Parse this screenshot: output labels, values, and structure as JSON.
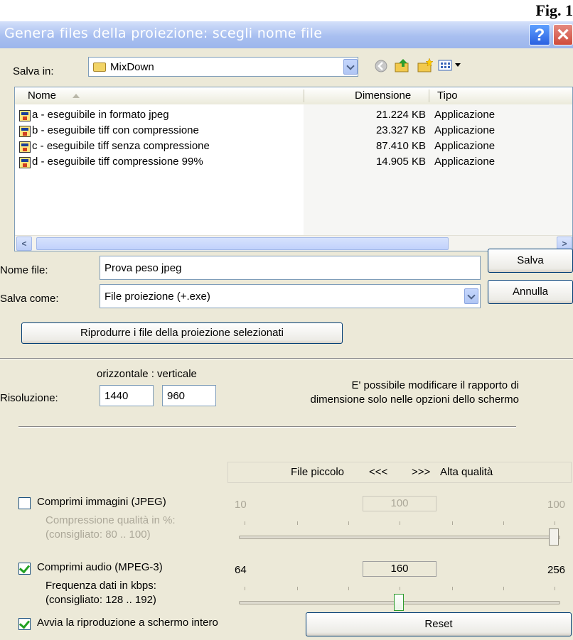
{
  "fig_label": "Fig. 1",
  "window": {
    "title": "Genera files della proiezione: scegli nome file",
    "help_glyph": "?",
    "close_glyph": "✕"
  },
  "save_in": {
    "label": "Salva in:",
    "folder": "MixDown"
  },
  "toolbar_icons": [
    "back-icon",
    "up-folder-icon",
    "new-folder-icon",
    "view-menu-icon"
  ],
  "file_list": {
    "headers": {
      "name": "Nome",
      "size": "Dimensione",
      "type": "Tipo"
    },
    "rows": [
      {
        "name": "a - eseguibile in formato jpeg",
        "size": "21.224 KB",
        "type": "Applicazione"
      },
      {
        "name": "b - eseguibile tiff con compressione",
        "size": "23.327 KB",
        "type": "Applicazione"
      },
      {
        "name": "c - eseguibile tiff senza compressione",
        "size": "87.410 KB",
        "type": "Applicazione"
      },
      {
        "name": "d - eseguibile tiff compressione 99%",
        "size": "14.905 KB",
        "type": "Applicazione"
      }
    ]
  },
  "filename": {
    "label": "Nome file:",
    "value": "Prova peso jpeg"
  },
  "save_as": {
    "label": "Salva come:",
    "value": "File proiezione (+.exe)"
  },
  "buttons": {
    "save": "Salva",
    "cancel": "Annulla",
    "play_selected": "Riprodurre i file della proiezione selezionati",
    "reset": "Reset"
  },
  "resolution": {
    "header": "orizzontale : verticale",
    "label": "Risoluzione:",
    "horizontal": "1440",
    "vertical": "960",
    "note_line1": "E' possibile modificare il rapporto di",
    "note_line2": "dimensione solo nelle opzioni dello schermo"
  },
  "quality_scale": {
    "left": "File piccolo",
    "left_arrows": "<<<",
    "right_arrows": ">>>",
    "right": "Alta qualità"
  },
  "jpeg": {
    "checked": false,
    "label": "Comprimi immagini (JPEG)",
    "sub1": "Compressione qualità in %:",
    "sub2": "(consigliato: 80 .. 100)",
    "min": "10",
    "value": "100",
    "max": "100",
    "fraction": 1.0
  },
  "audio": {
    "checked": true,
    "label": "Comprimi audio (MPEG-3)",
    "sub1": "Frequenza dati in kbps:",
    "sub2": "(consigliato: 128 .. 192)",
    "min": "64",
    "value": "160",
    "max": "256",
    "fraction": 0.5
  },
  "fullscreen": {
    "checked": true,
    "label": "Avvia la riproduzione a schermo intero"
  },
  "colors": {
    "title_bg": "#9db6ec",
    "dialog_bg": "#ece9d8",
    "check_green": "#21a121"
  }
}
